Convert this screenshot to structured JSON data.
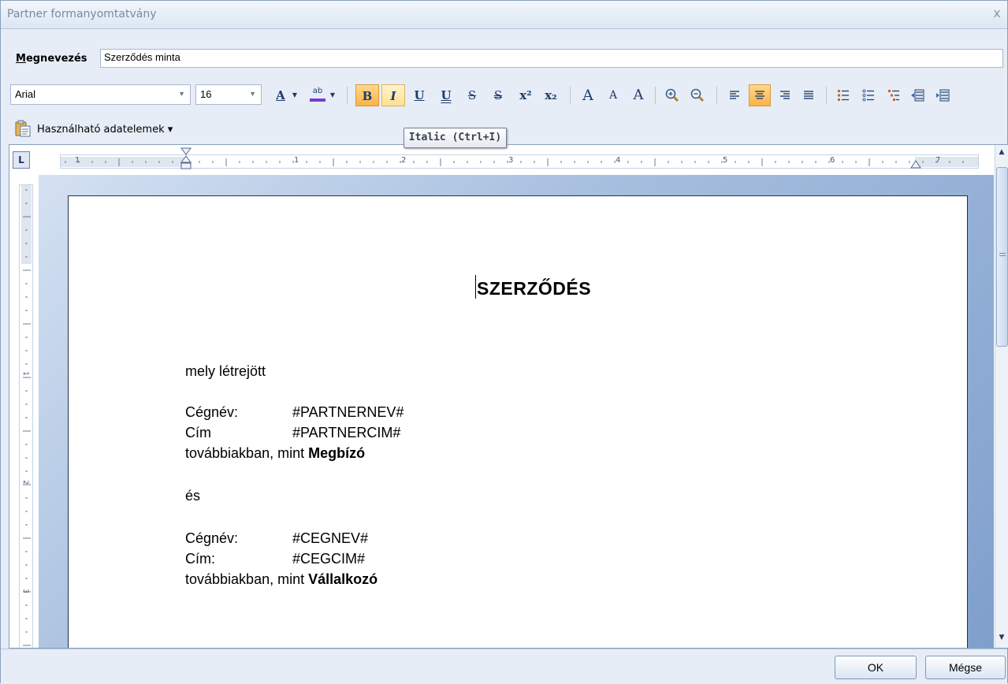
{
  "window": {
    "title": "Partner formanyomtatvány",
    "close_glyph": "x"
  },
  "name_field": {
    "label_first": "M",
    "label_rest": "egnevezés",
    "value": "Szerződés minta"
  },
  "toolbar": {
    "font_name": "Arial",
    "font_size": "16",
    "buttons": {
      "font_color": "A",
      "highlight": "ab",
      "bold": "B",
      "italic": "I",
      "underline": "U",
      "double_underline": "U",
      "strikethrough": "S",
      "double_strikethrough": "S",
      "superscript": "x²",
      "subscript": "x₂",
      "grow_font": "A",
      "shrink_font": "A",
      "clear_format": "A"
    },
    "active": [
      "bold",
      "align-center"
    ],
    "hovered": "italic"
  },
  "data_elements": {
    "label": "Használható adatelemek ▾"
  },
  "tooltip": {
    "text": "Italic (Ctrl+I)"
  },
  "ruler": {
    "h_numbers": [
      "1",
      "1",
      "2",
      "3",
      "4",
      "5",
      "6",
      "7"
    ],
    "v_numbers": [
      "1",
      "2",
      "3"
    ],
    "corner": "L"
  },
  "document": {
    "title": "SZERZŐDÉS",
    "intro": "mely létrejött",
    "party1": {
      "name_label": "Cégnév:",
      "name_value": "#PARTNERNEV#",
      "addr_label": "Cím",
      "addr_value": "#PARTNERCIM#",
      "role_prefix": "továbbiakban, mint ",
      "role": "Megbízó"
    },
    "and": "és",
    "party2": {
      "name_label": "Cégnév:",
      "name_value": "#CEGNEV#",
      "addr_label": "Cím:",
      "addr_value": "#CEGCIM#",
      "role_prefix": "továbbiakban, mint ",
      "role": "Vállalkozó"
    }
  },
  "footer": {
    "ok": "OK",
    "cancel": "Mégse"
  },
  "colors": {
    "active_button": "#fbb24a",
    "window_bg": "#e6edf6",
    "canvas": "#7f9fcc"
  }
}
